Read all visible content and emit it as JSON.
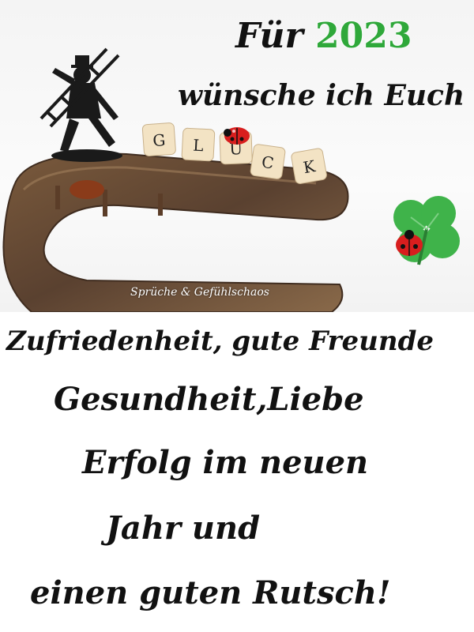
{
  "header": {
    "line1_prefix": "Für",
    "line1_year": "2023",
    "line2": "wünsche ich Euch"
  },
  "dice_letters": [
    "G",
    "L",
    "Ü",
    "C",
    "K"
  ],
  "watermark": "Sprüche & Gefühlschaos",
  "wishes": {
    "line1": "Zufriedenheit, gute Freunde",
    "line2": "Gesundheit,Liebe",
    "line3": "Erfolg im neuen",
    "line4": "Jahr und",
    "line5": "einen guten Rutsch!"
  },
  "colors": {
    "year_green": "#2fa83a",
    "text": "#111111",
    "ladybug_red": "#d81e1e",
    "clover_green": "#3fb34a"
  }
}
